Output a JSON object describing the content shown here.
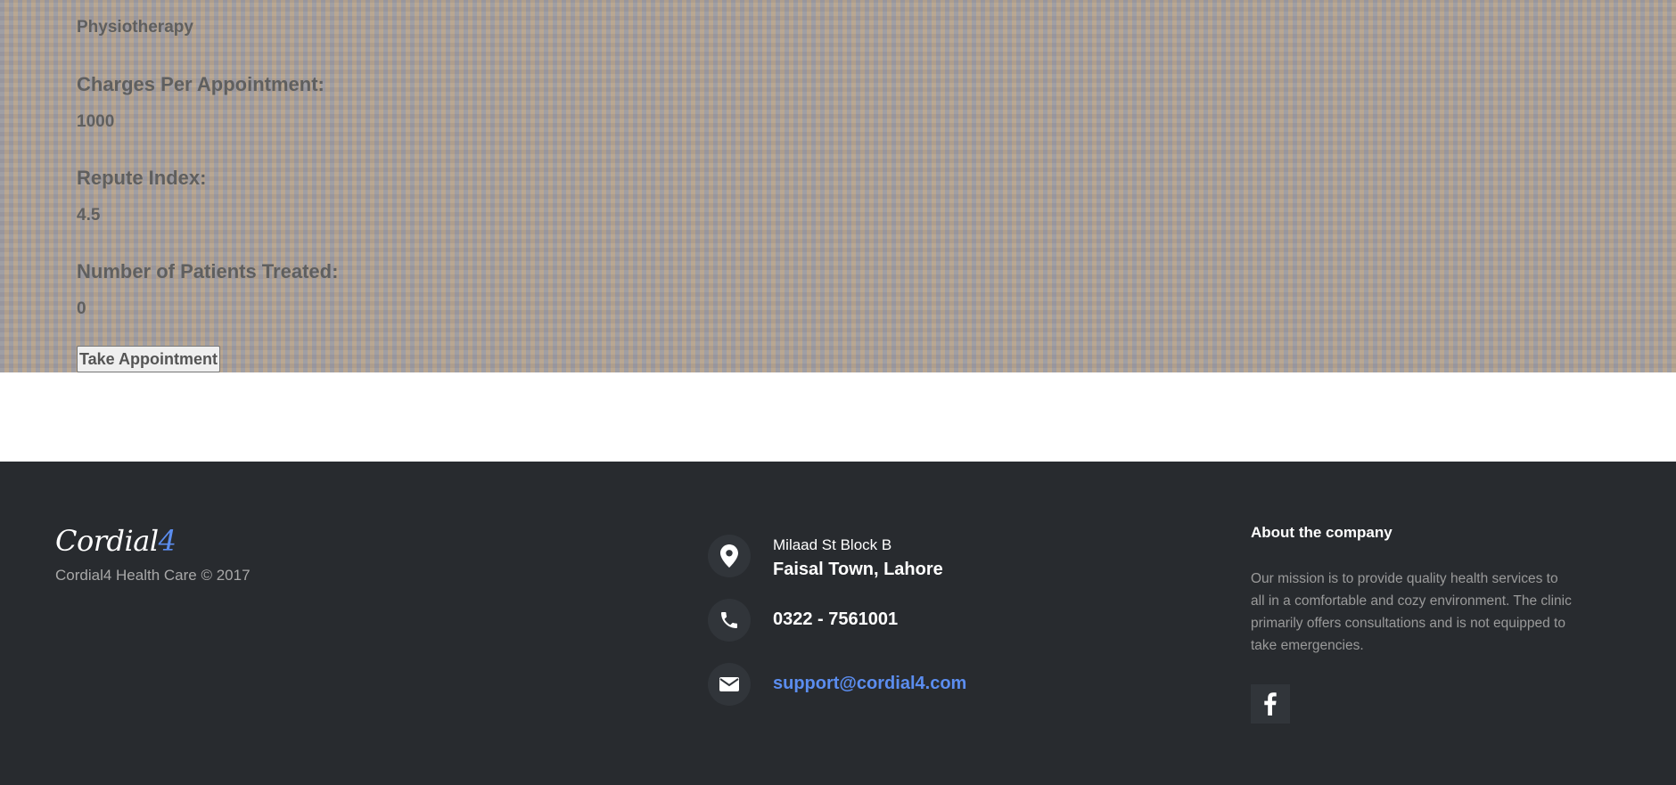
{
  "doctor_details": {
    "specialty_value": "Physiotherapy",
    "charges_label": "Charges Per Appointment:",
    "charges_value": "1000",
    "repute_label": "Repute Index:",
    "repute_value": "4.5",
    "patients_label": "Number of Patients Treated:",
    "patients_value": "0",
    "take_appointment_label": "Take Appointment"
  },
  "footer": {
    "logo_text": "Cordial",
    "logo_accent": "4",
    "copyright": "Cordial4 Health Care © 2017",
    "address_line1": "Milaad St Block B",
    "address_line2": "Faisal Town, Lahore",
    "phone": "0322 - 7561001",
    "email": "support@cordial4.com",
    "about_title": "About the company",
    "about_text": "Our mission is to provide quality health services to all in a comfortable and cozy environment. The clinic primarily offers consultations and is not equipped to take emergencies.",
    "icons": [
      "map-marker-icon",
      "phone-icon",
      "envelope-icon",
      "facebook-icon"
    ]
  },
  "colors": {
    "accent": "#5b8def",
    "footer_bg": "#282b2f",
    "label_text": "#5f5f5f"
  }
}
